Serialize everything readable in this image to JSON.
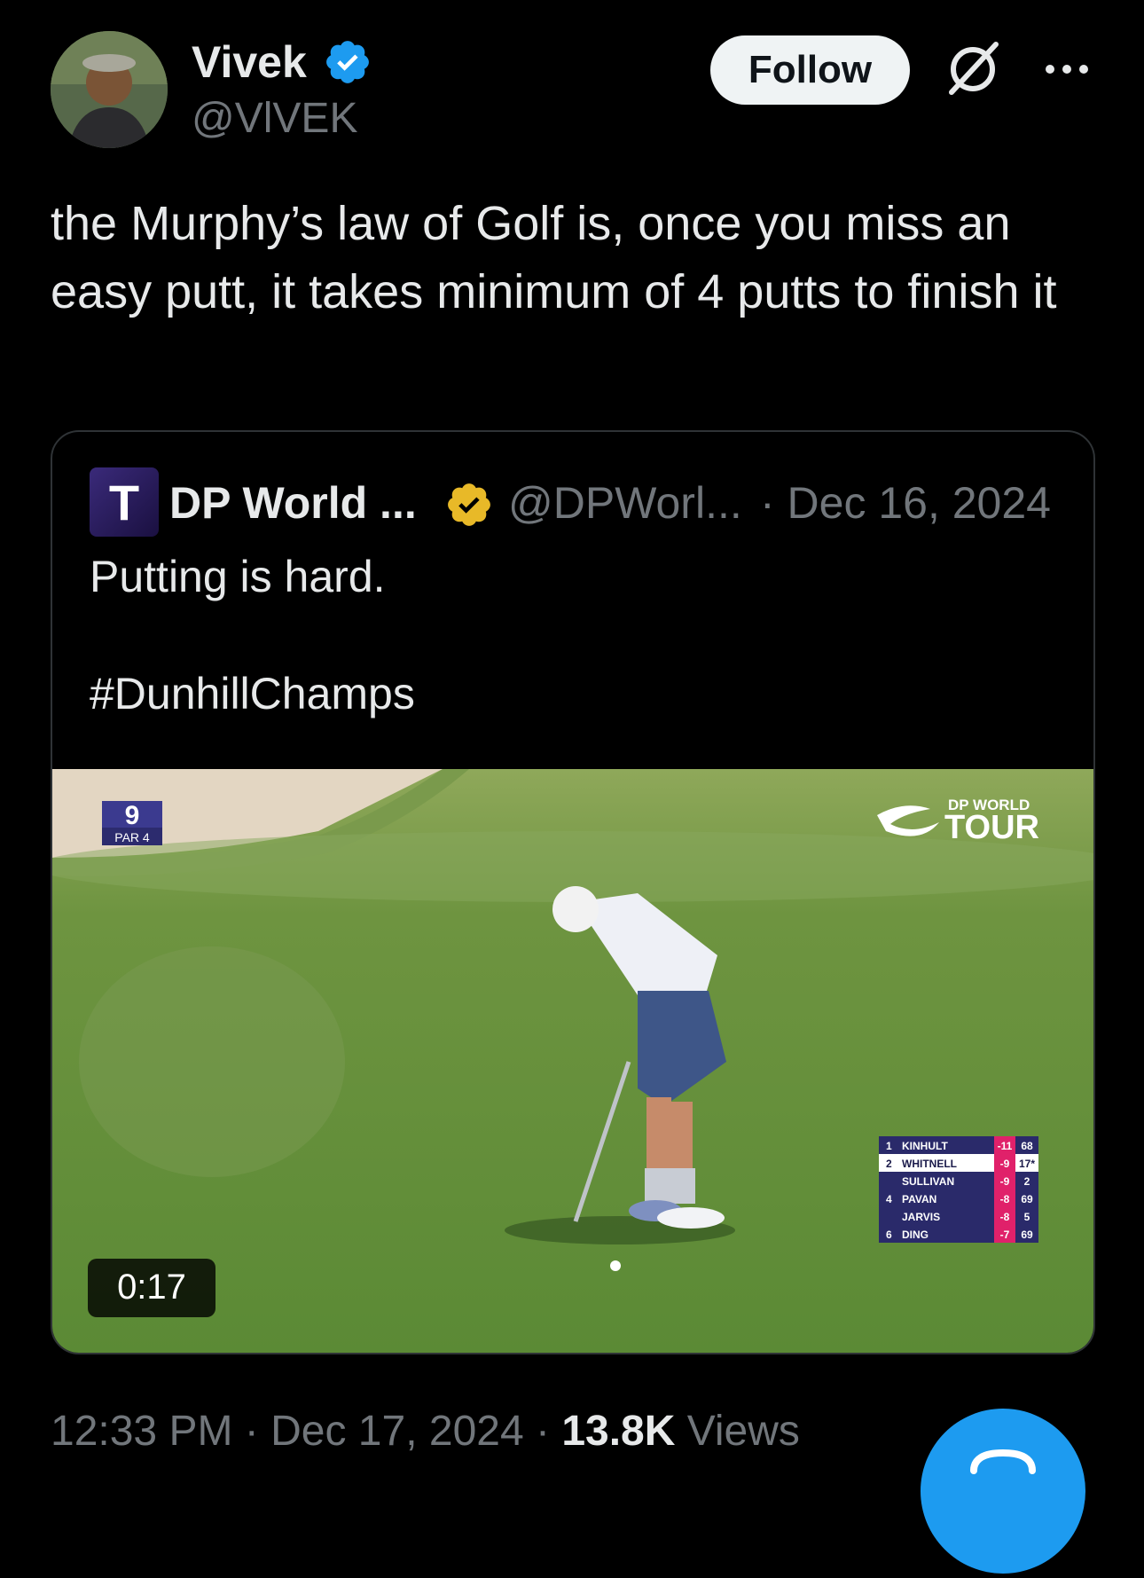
{
  "author": {
    "display_name": "Vivek",
    "handle": "@VlVEK",
    "verified_color": "#1d9bf0"
  },
  "actions": {
    "follow_label": "Follow",
    "grok_icon": "grok-icon",
    "more_icon": "more-icon"
  },
  "tweet": {
    "text": "the Murphy’s law of Golf is, once you miss an easy putt, it takes minimum of 4 putts to finish it"
  },
  "quoted_tweet": {
    "display_name": "DP World ...",
    "handle": "@DPWorl...",
    "date": "· Dec 16, 2024",
    "text": "Putting is hard.",
    "hashtag": "#DunhillChamps",
    "badge_color": "#e8b928",
    "avatar_letter": "T",
    "media": {
      "duration": "0:17",
      "hole_number": "9",
      "hole_par": "PAR 4",
      "brand_top": "DP WORLD",
      "brand_bottom": "TOUR",
      "leaderboard": [
        {
          "pos": "1",
          "name": "KINHULT",
          "score": "-11",
          "thru": "68",
          "highlight": false
        },
        {
          "pos": "2",
          "name": "WHITNELL",
          "score": "-9",
          "thru": "17*",
          "highlight": true
        },
        {
          "pos": "",
          "name": "SULLIVAN",
          "score": "-9",
          "thru": "2",
          "highlight": false
        },
        {
          "pos": "4",
          "name": "PAVAN",
          "score": "-8",
          "thru": "69",
          "highlight": false
        },
        {
          "pos": "",
          "name": "JARVIS",
          "score": "-8",
          "thru": "5",
          "highlight": false
        },
        {
          "pos": "6",
          "name": "DING",
          "score": "-7",
          "thru": "69",
          "highlight": false
        }
      ]
    }
  },
  "footer": {
    "time_date": "12:33 PM · Dec 17, 2024 · ",
    "views_count": "13.8K",
    "views_label": " Views"
  },
  "fab": {
    "color": "#1d9bf0"
  }
}
